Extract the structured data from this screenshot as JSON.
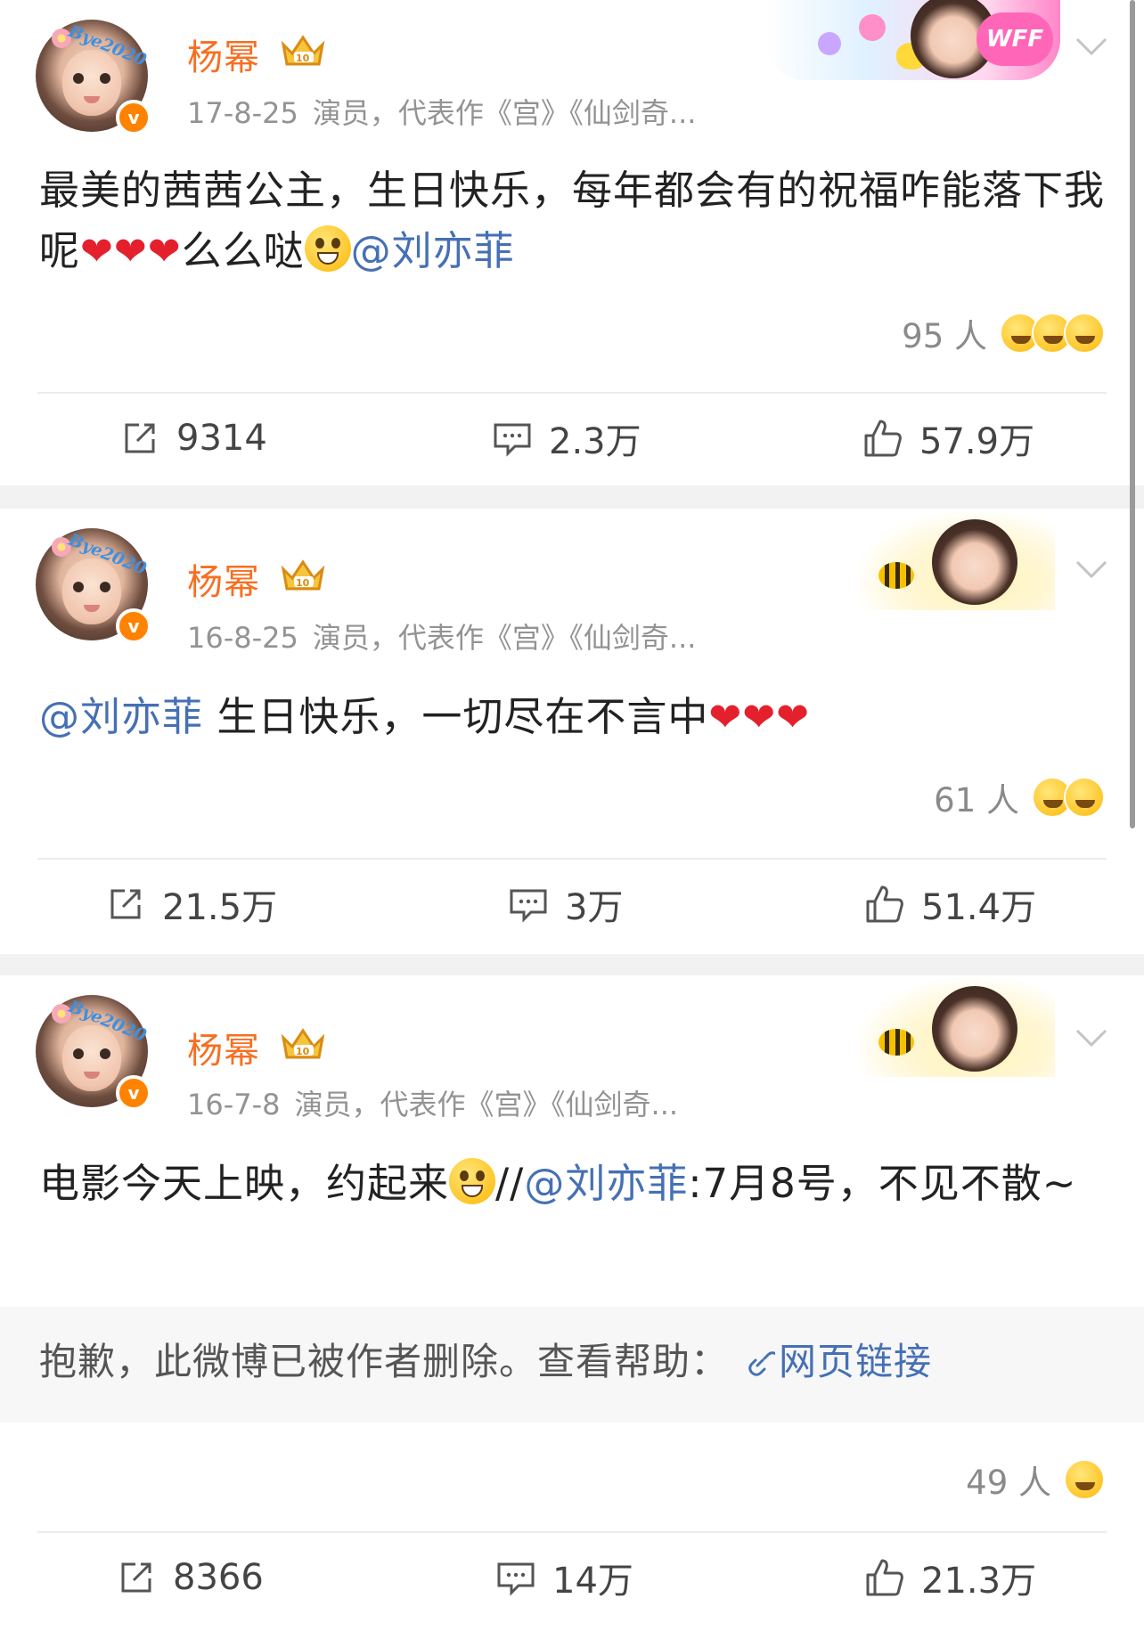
{
  "colors": {
    "username": "#f86e21",
    "mention": "#4570b4",
    "verified": "#ff8200",
    "heart": "#e5202d"
  },
  "avatar_tag": "Bye2020",
  "posts": [
    {
      "username": "杨幂",
      "date": "17-8-25",
      "description": "演员，代表作《宫》《仙剑奇...",
      "card_label": "WFF",
      "content_text": "最美的茜茜公主，生日快乐，每年都会有的祝福咋能落下我呢",
      "hearts": "❤❤❤",
      "content_after": "么么哒",
      "mention": "@刘亦菲",
      "reaction_count": "95 人",
      "reaction_icons": [
        "laugh-emoji",
        "shocked-emoji",
        "kiss-emoji"
      ],
      "reposts": "9314",
      "comments": "2.3万",
      "likes": "57.9万"
    },
    {
      "username": "杨幂",
      "date": "16-8-25",
      "description": "演员，代表作《宫》《仙剑奇...",
      "mention": "@刘亦菲",
      "content_text": " 生日快乐，一切尽在不言中",
      "hearts": "❤❤❤",
      "reaction_count": "61 人",
      "reaction_icons": [
        "laugh-emoji",
        "kiss-emoji"
      ],
      "reposts": "21.5万",
      "comments": "3万",
      "likes": "51.4万"
    },
    {
      "username": "杨幂",
      "date": "16-7-8",
      "description": "演员，代表作《宫》《仙剑奇...",
      "content_text": "电影今天上映，约起来",
      "repost_prefix": "//",
      "mention": "@刘亦菲",
      "content_after": ":7月8号，不见不散~",
      "deleted_notice": "抱歉，此微博已被作者删除。查看帮助：",
      "deleted_link": "网页链接",
      "reaction_count": "49 人",
      "reaction_icons": [
        "laugh-emoji"
      ],
      "reposts": "8366",
      "comments": "14万",
      "likes": "21.3万"
    }
  ]
}
